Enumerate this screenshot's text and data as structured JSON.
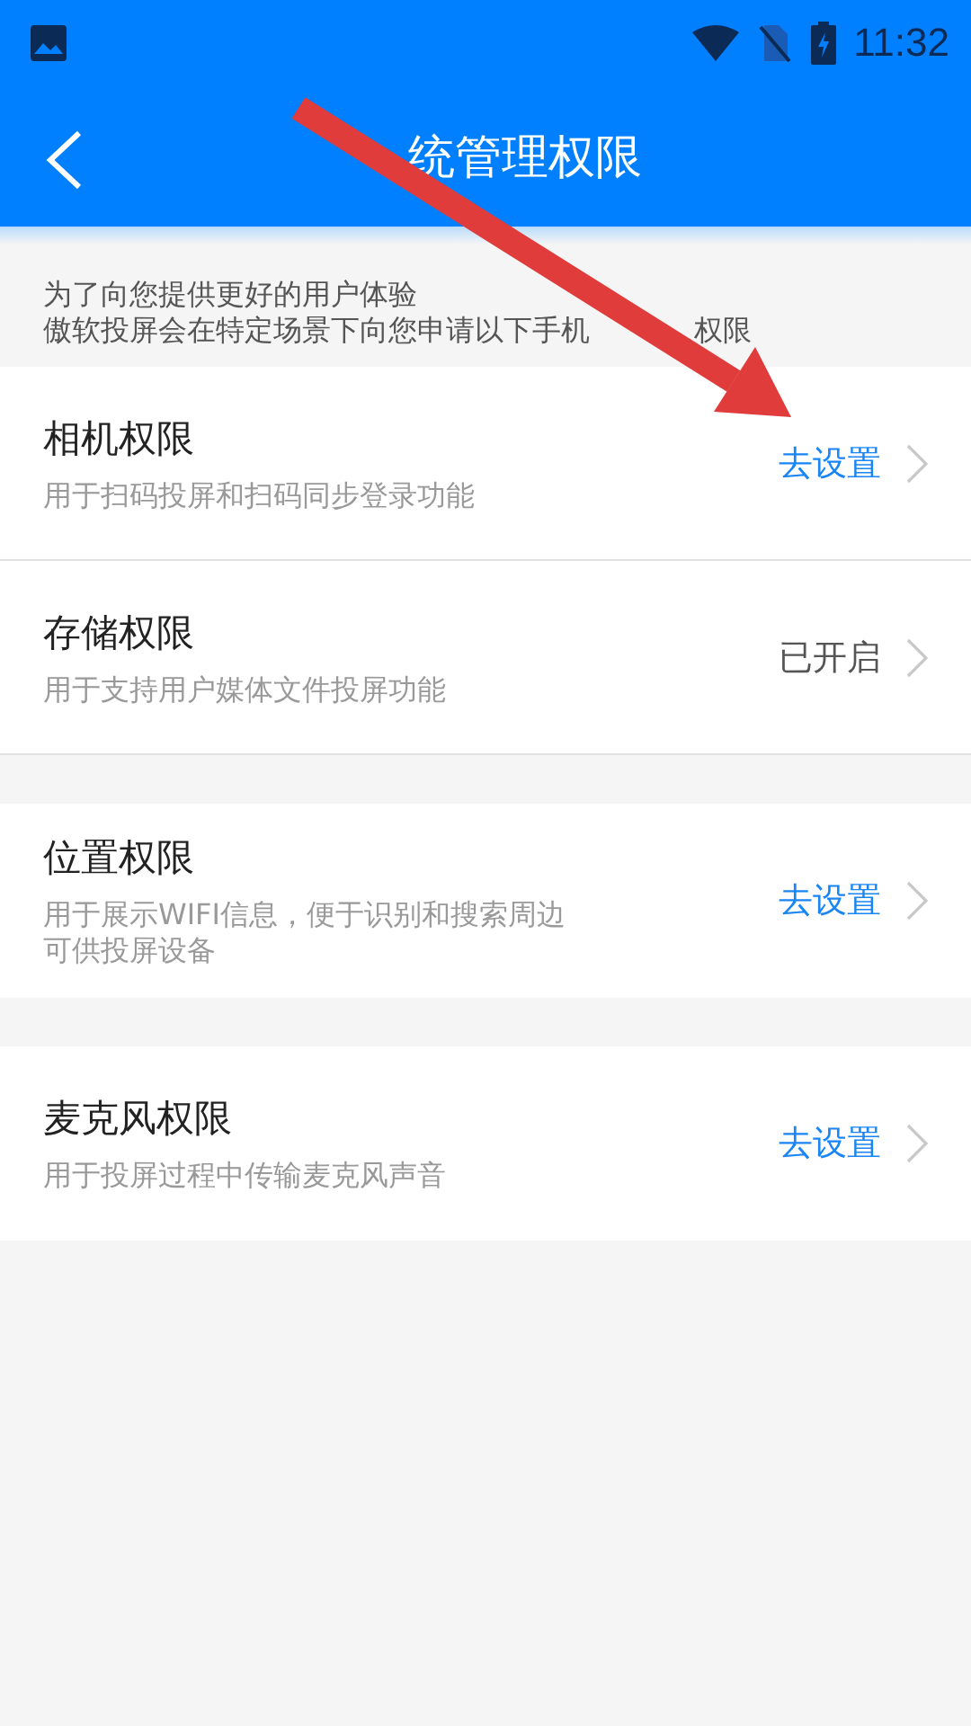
{
  "status_bar": {
    "time": "11:32"
  },
  "toolbar": {
    "title": "统管理权限"
  },
  "intro": [
    [
      "为了向您提供更好的用户体验"
    ],
    [
      "傲软投屏会在特定场景下向您申请以下手机",
      "权限"
    ]
  ],
  "groups": [
    {
      "items": [
        {
          "title": "相机权限",
          "description": "用于扫码投屏和扫码同步登录功能",
          "action": "去设置",
          "enabled": false
        },
        {
          "title": "存储权限",
          "description": "用于支持用户媒体文件投屏功能",
          "action": "已开启",
          "enabled": true
        }
      ]
    },
    {
      "items": [
        {
          "title": "位置权限",
          "description": "用于展示WIFI信息，便于识别和搜索周边可供投屏设备",
          "action": "去设置",
          "enabled": false
        }
      ]
    },
    {
      "items": [
        {
          "title": "麦克风权限",
          "description": "用于投屏过程中传输麦克风声音",
          "action": "去设置",
          "enabled": false
        }
      ]
    }
  ]
}
